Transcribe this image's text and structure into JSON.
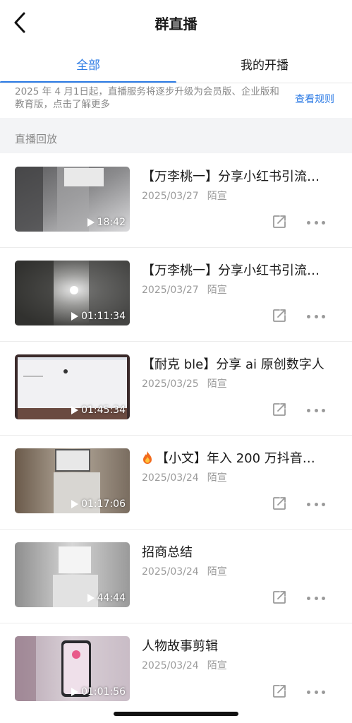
{
  "nav": {
    "title": "群直播"
  },
  "tabs": [
    {
      "label": "全部",
      "active": true
    },
    {
      "label": "我的开播",
      "active": false
    }
  ],
  "notice": {
    "text": "2025 年 4 月1日起，直播服务将逐步升级为会员版、企业版和教育版，点击了解更多",
    "link": "查看规则"
  },
  "section": {
    "title": "直播回放"
  },
  "items": [
    {
      "title": "【万李桃一】分享小红书引流…",
      "date": "2025/03/27",
      "author": "陌宣",
      "duration": "18:42"
    },
    {
      "title": "【万李桃一】分享小红书引流…",
      "date": "2025/03/27",
      "author": "陌宣",
      "duration": "01:11:34"
    },
    {
      "title": "【耐克 ble】分享 ai 原创数字人",
      "date": "2025/03/25",
      "author": "陌宣",
      "duration": "01:45:34"
    },
    {
      "title": "【小文】年入 200 万抖音…",
      "date": "2025/03/24",
      "author": "陌宣",
      "duration": "01:17:06",
      "emoji": "fire-icon"
    },
    {
      "title": "招商总结",
      "date": "2025/03/24",
      "author": "陌宣",
      "duration": "44:44"
    },
    {
      "title": "人物故事剪辑",
      "date": "2025/03/24",
      "author": "陌宣",
      "duration": "01:01:56"
    }
  ],
  "colors": {
    "accent": "#2c7be5",
    "muted": "#9b9b9b",
    "section_bg": "#f3f4f6"
  }
}
